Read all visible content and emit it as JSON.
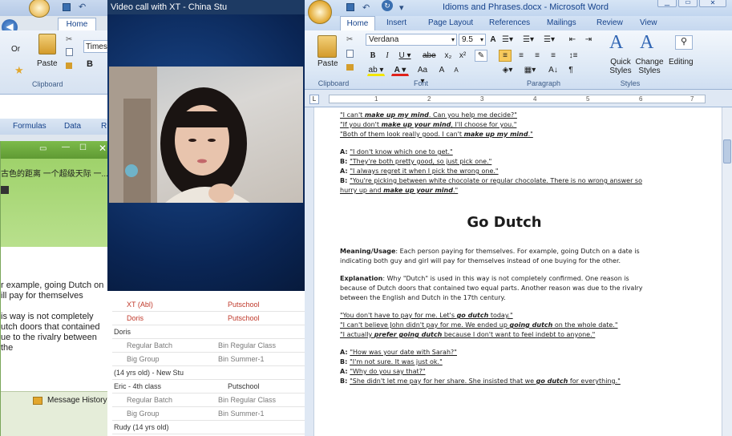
{
  "excel": {
    "left_tab": "Home",
    "sheet_cell_label": "Or",
    "menu_tabs": [
      "Formulas",
      "Data",
      "R"
    ]
  },
  "excel_font": {
    "font_box": "Times",
    "bold": "B",
    "paste": "Paste",
    "clipboard": "Clipboard"
  },
  "chat": {
    "cjk_title": "古色的距离 一个超级天际 一...",
    "body_lines": [
      "r example, going Dutch on",
      "ill pay for themselves",
      "",
      "is way is not completely",
      "utch doors that contained",
      "ue to the rivalry between the"
    ],
    "message_history": "Message History"
  },
  "video": {
    "title": "Video call with XT - China Stu"
  },
  "schedule": [
    {
      "left": "XT (Abl)",
      "right": "Putschool",
      "left_color": "#c0392b",
      "right_color": "#c0392b"
    },
    {
      "left": "Doris",
      "right": "Putschool",
      "left_color": "#c0392b",
      "right_color": "#c0392b"
    },
    {
      "left": "Doris",
      "right": "",
      "left_color": "#333",
      "right_color": "#333"
    },
    {
      "left": "Regular Batch",
      "right": "Bin Regular Class",
      "left_color": "#7a7a7a",
      "right_color": "#7a7a7a"
    },
    {
      "left": "Big Group",
      "right": "Bin Summer-1",
      "left_color": "#7a7a7a",
      "right_color": "#7a7a7a"
    },
    {
      "left": "(14 yrs old) - New Stu",
      "right": "",
      "left_color": "#333",
      "right_color": "#333"
    },
    {
      "left": "Eric - 4th class",
      "right": "Putschool",
      "left_color": "#333",
      "right_color": "#333"
    },
    {
      "left": "Regular Batch",
      "right": "Bin Regular Class",
      "left_color": "#7a7a7a",
      "right_color": "#7a7a7a"
    },
    {
      "left": "Big Group",
      "right": "Bin Summer-1",
      "left_color": "#7a7a7a",
      "right_color": "#7a7a7a"
    },
    {
      "left": "Rudy (14 yrs old)",
      "right": "",
      "left_color": "#333",
      "right_color": "#333"
    }
  ],
  "word": {
    "title": "Idioms and Phrases.docx - Microsoft Word",
    "tabs": [
      "Home",
      "Insert",
      "Page Layout",
      "References",
      "Mailings",
      "Review",
      "View"
    ],
    "font_name": "Verdana",
    "font_size": "9.5",
    "paste": "Paste",
    "clipboard": "Clipboard",
    "font_group": "Font",
    "paragraph_group": "Paragraph",
    "styles_group": "Styles",
    "quick_styles": "Quick Styles",
    "change_styles": "Change Styles",
    "editing": "Editing",
    "ruler_marks": [
      "1",
      "2",
      "3",
      "4",
      "5",
      "6",
      "7"
    ]
  },
  "doc": {
    "p1": [
      [
        "\"I can't ",
        ""
      ],
      [
        "make up my mind",
        "bi"
      ],
      [
        ". Can you help me decide?\"",
        ""
      ]
    ],
    "p2": [
      [
        "\"If you don't ",
        ""
      ],
      [
        "make up your mind",
        "bi"
      ],
      [
        ", I'll choose for you.\"",
        ""
      ]
    ],
    "p3": [
      [
        "\"Both of them look really good. I can't ",
        ""
      ],
      [
        "make up my mind",
        "bi"
      ],
      [
        ".\"",
        ""
      ]
    ],
    "d1": [
      [
        "A: ",
        "b"
      ],
      [
        "\"I don't know which one to get.\"",
        ""
      ]
    ],
    "d2": [
      [
        "B: ",
        "b"
      ],
      [
        "\"They're both pretty good, so just pick one.\"",
        ""
      ]
    ],
    "d3": [
      [
        "A: ",
        "b"
      ],
      [
        "\"I always regret it when I pick the wrong one.\"",
        ""
      ]
    ],
    "d4": [
      [
        "B: ",
        "b"
      ],
      [
        "\"You're picking between white chocolate or regular chocolate. There is no wrong answer so",
        ""
      ]
    ],
    "d5": [
      [
        "hurry up and ",
        ""
      ],
      [
        "make up your mind",
        "bi"
      ],
      [
        ".\"",
        ""
      ]
    ],
    "heading": "Go Dutch",
    "meaning_label": "Meaning/Usage",
    "meaning_line1": ": Each person paying for themselves. For example, going Dutch on a date is",
    "meaning_line2": "indicating both guy and girl will pay for themselves instead of one buying for the other.",
    "expl_label": "Explanation",
    "expl_line1": ": Why \"Dutch\" is used in this way is not completely confirmed. One reason is",
    "expl_line2": "because of Dutch doors that contained two equal parts. Another reason was due to the rivalry",
    "expl_line3": "between the English and Dutch in the 17th century.",
    "e1": [
      [
        "\"You don't have to pay for me. Let's ",
        ""
      ],
      [
        "go dutch",
        "bi"
      ],
      [
        " today.\"",
        ""
      ]
    ],
    "e2": [
      [
        "\"I can't believe John didn't pay for me. We ended up ",
        ""
      ],
      [
        "going dutch",
        "bi"
      ],
      [
        " on the whole date.\"",
        ""
      ]
    ],
    "e3": [
      [
        "\"I actually ",
        ""
      ],
      [
        "prefer going dutch",
        "bi"
      ],
      [
        " because I don't want to feel indebt to anyone.\"",
        ""
      ]
    ],
    "f1": [
      [
        "A: ",
        "b"
      ],
      [
        "\"How was your date with Sarah?\"",
        ""
      ]
    ],
    "f2": [
      [
        "B: ",
        "b"
      ],
      [
        "\"I'm not sure. It was just ok.\"",
        ""
      ]
    ],
    "f3": [
      [
        "A: ",
        "b"
      ],
      [
        "\"Why do you say that?\"",
        ""
      ]
    ],
    "f4": [
      [
        "B: ",
        "b"
      ],
      [
        "\"She didn't let me pay for her share. She insisted that we ",
        ""
      ],
      [
        "go dutch",
        "bi"
      ],
      [
        " for everything.\"",
        ""
      ]
    ]
  },
  "colors": {
    "word_accent": "#15428b",
    "video_title_bg": "#1d3a63",
    "chat_green": "#6aa83f"
  }
}
